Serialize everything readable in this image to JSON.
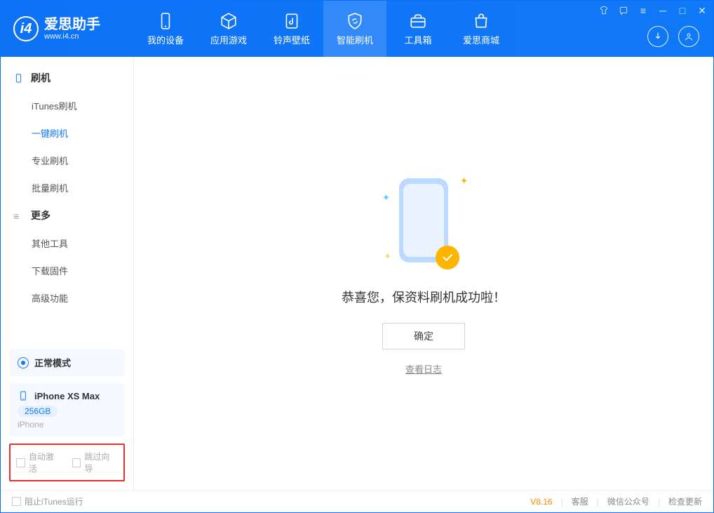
{
  "logo": {
    "title": "爱思助手",
    "subtitle": "www.i4.cn"
  },
  "nav": {
    "device": "我的设备",
    "apps": "应用游戏",
    "rings": "铃声壁纸",
    "flash": "智能刷机",
    "tools": "工具箱",
    "store": "爱思商城"
  },
  "sidebar": {
    "section1": "刷机",
    "items1": [
      "iTunes刷机",
      "一键刷机",
      "专业刷机",
      "批量刷机"
    ],
    "section2": "更多",
    "items2": [
      "其他工具",
      "下载固件",
      "高级功能"
    ]
  },
  "mode": {
    "label": "正常模式"
  },
  "device": {
    "name": "iPhone XS Max",
    "storage": "256GB",
    "type": "iPhone"
  },
  "options": {
    "auto_activate": "自动激活",
    "skip_guide": "跳过向导"
  },
  "main": {
    "success": "恭喜您，保资料刷机成功啦！",
    "ok": "确定",
    "view_log": "查看日志"
  },
  "footer": {
    "block_itunes": "阻止iTunes运行",
    "version": "V8.16",
    "service": "客服",
    "wechat": "微信公众号",
    "update": "检查更新"
  }
}
